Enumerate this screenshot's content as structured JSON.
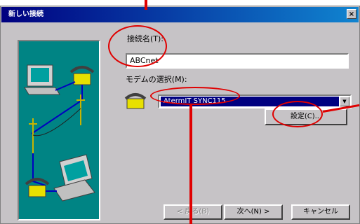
{
  "window": {
    "title": "新しい接続",
    "close_glyph": "×"
  },
  "form": {
    "name_label": "接続名(T):",
    "name_value": "ABCnet",
    "modem_label": "モデムの選択(M):",
    "modem_value": "AtermIT SYNC115",
    "dropdown_glyph": "▼"
  },
  "buttons": {
    "settings": "設定(C)...",
    "back": "< 戻る(B)",
    "next": "次へ(N) >",
    "cancel": "キャンセル"
  },
  "annotations": {
    "color": "#e00000"
  }
}
